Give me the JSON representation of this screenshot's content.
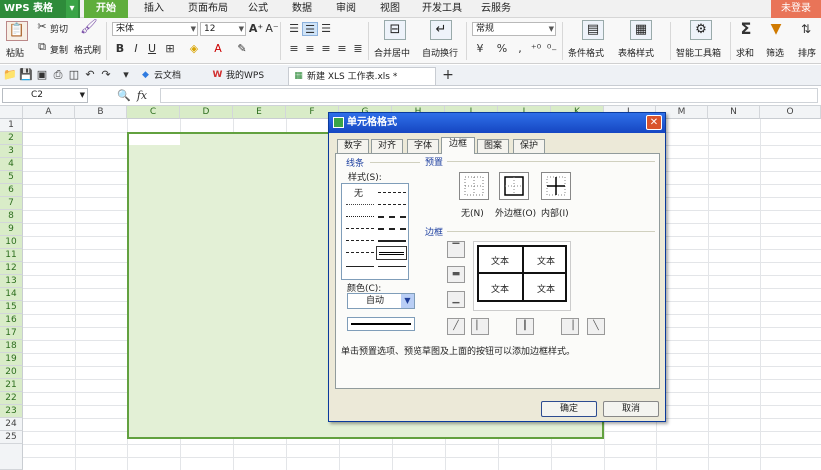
{
  "app": {
    "name": "WPS 表格",
    "login": "未登录"
  },
  "menu": [
    "开始",
    "插入",
    "页面布局",
    "公式",
    "数据",
    "审阅",
    "视图",
    "开发工具",
    "云服务"
  ],
  "ribbon": {
    "paste": "粘贴",
    "cut": "剪切",
    "copy": "复制",
    "format_painter": "格式刷",
    "font_name": "宋体",
    "font_size": "12",
    "merge_center": "合并居中",
    "auto_wrap": "自动换行",
    "number_format": "常规",
    "conditional_format": "条件格式",
    "table_style": "表格样式",
    "smart_toolbox": "智能工具箱",
    "sum": "求和",
    "filter": "筛选",
    "sort": "排序"
  },
  "tabs": {
    "cloud": "云文档",
    "mywps": "我的WPS",
    "doc": "新建 XLS 工作表.xls *",
    "add": "+"
  },
  "formula_bar": {
    "cell_ref": "C2",
    "fx": "fx"
  },
  "columns": [
    "A",
    "B",
    "C",
    "D",
    "E",
    "F",
    "G",
    "H",
    "I",
    "J",
    "K",
    "L",
    "M",
    "N",
    "O"
  ],
  "rows": [
    "1",
    "2",
    "3",
    "4",
    "5",
    "6",
    "7",
    "8",
    "9",
    "10",
    "11",
    "12",
    "13",
    "14",
    "15",
    "16",
    "17",
    "18",
    "19",
    "20",
    "21",
    "22",
    "23",
    "24",
    "25"
  ],
  "dialog": {
    "title": "单元格格式",
    "tabs": [
      "数字",
      "对齐",
      "字体",
      "边框",
      "图案",
      "保护"
    ],
    "line_group": "线条",
    "style_label": "样式(S):",
    "none_style": "无",
    "color_label": "颜色(C):",
    "color_value": "自动",
    "preset_group": "预置",
    "preset_none": "无(N)",
    "preset_outline": "外边框(O)",
    "preset_inside": "内部(I)",
    "border_group": "边框",
    "preview_text": "文本",
    "hint": "单击预置选项、预览草图及上面的按钮可以添加边框样式。",
    "ok": "确定",
    "cancel": "取消"
  }
}
